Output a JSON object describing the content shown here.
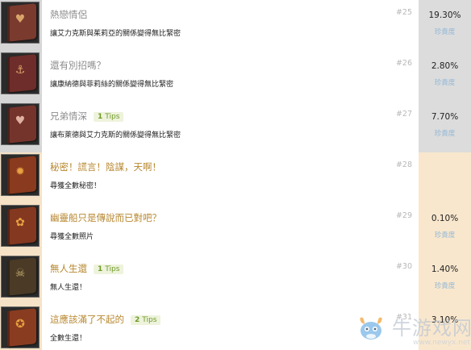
{
  "achievements": [
    {
      "title": "熱戀情侶",
      "tips": "",
      "desc": "讓艾力克斯與茱莉亞的關係變得無比緊密",
      "number": "#25",
      "percent": "19.30%",
      "rarity": "珍貴度",
      "theme": "gray",
      "cover_color": "#7a3a2e",
      "emblem": "♥",
      "icon": "couple-book-icon"
    },
    {
      "title": "還有別招嗎？",
      "tips": "",
      "desc": "讓康納德與菲莉絲的關係變得無比緊密",
      "number": "#26",
      "percent": "2.80%",
      "rarity": "珍貴度",
      "theme": "gray",
      "cover_color": "#6e2d2a",
      "emblem": "⚓",
      "icon": "anchor-book-icon"
    },
    {
      "title": "兄弟情深",
      "tips": "1 Tips",
      "desc": "讓布萊德與艾力克斯的關係變得無比緊密",
      "number": "#27",
      "percent": "7.70%",
      "rarity": "珍貴度",
      "theme": "gray",
      "cover_color": "#74342c",
      "emblem": "♥",
      "icon": "heart-book-icon"
    },
    {
      "title": "秘密！謊言！陰謀，天啊！",
      "tips": "",
      "desc": "尋獲全數秘密！",
      "number": "#28",
      "percent": "",
      "rarity": "",
      "theme": "peach",
      "cover_color": "#8a3a1e",
      "emblem": "✹",
      "icon": "secret-book-icon"
    },
    {
      "title": "幽靈船只是傳說而已對吧？",
      "tips": "",
      "desc": "尋獲全數照片",
      "number": "#29",
      "percent": "0.10%",
      "rarity": "珍貴度",
      "theme": "peach",
      "cover_color": "#843820",
      "emblem": "✿",
      "icon": "ghost-ship-book-icon"
    },
    {
      "title": "無人生還",
      "tips": "1 Tips",
      "desc": "無人生還！",
      "number": "#30",
      "percent": "1.40%",
      "rarity": "珍貴度",
      "theme": "peach",
      "cover_color": "#4a3a26",
      "emblem": "☠",
      "icon": "skull-book-icon"
    },
    {
      "title": "這應該滿了不起的",
      "tips": "2 Tips",
      "desc": "全數生還！",
      "number": "#31",
      "percent": "3.10%",
      "rarity": "",
      "theme": "peach",
      "cover_color": "#8a3c20",
      "emblem": "✪",
      "icon": "medal-book-icon"
    }
  ],
  "watermark": {
    "text": "牛游戏网",
    "url": "www.newyx.net"
  }
}
